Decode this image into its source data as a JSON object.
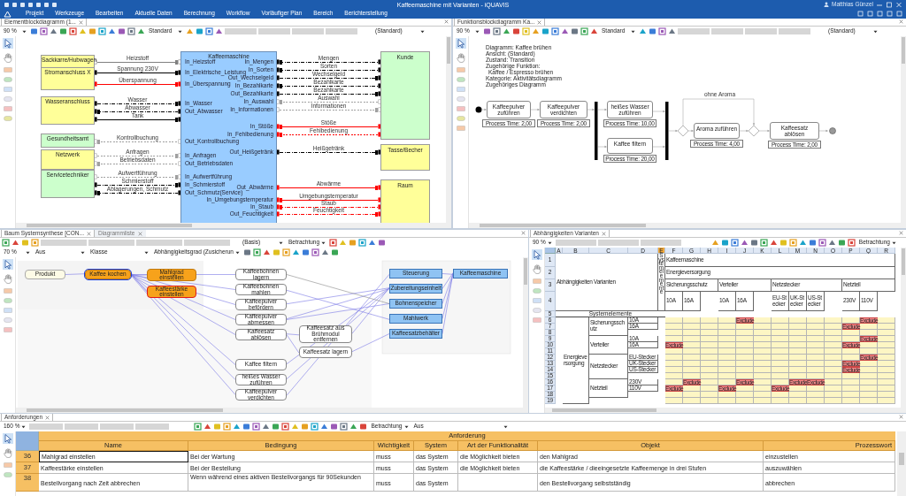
{
  "app": {
    "title": "Kaffeemaschine mit Varianten - iQUAVIS",
    "user": "Matthias Günzel",
    "menu": [
      "Projekt",
      "Werkzeuge",
      "Bearbeiten",
      "Aktuelle Daten",
      "Berechnung",
      "Workflow",
      "Vorläufiger Plan",
      "Bereich",
      "Berichterstellung"
    ]
  },
  "block_diagram": {
    "tab": {
      "label": "Elementblockdiagramm (1...",
      "selected": true
    },
    "zoom": "90 %",
    "view": "Standard",
    "state": "(Standard)",
    "center_block": "Kaffeemaschine",
    "left_blocks": [
      {
        "label": "Sackkarre/Hubwagen",
        "color": "#ffff99"
      },
      {
        "label": "Stromanschluss X",
        "color": "#ffff99"
      },
      {
        "label": "Wasseranschluss",
        "color": "#ffff99"
      },
      {
        "label": "Gesundheitsamt",
        "color": "#ccffcc"
      },
      {
        "label": "Netzwerk",
        "color": "#ffff99"
      },
      {
        "label": "Servicetechniker",
        "color": "#ccffcc"
      }
    ],
    "right_blocks": [
      {
        "label": "Kunde",
        "color": "#ccffcc"
      },
      {
        "label": "Tasse/Becher",
        "color": "#ffff99"
      },
      {
        "label": "Raum",
        "color": "#ffff99"
      }
    ],
    "left_connections": [
      {
        "label": "Heizstoff",
        "port": "In_Heizstoff",
        "color": "#808080",
        "kind": "solid_in"
      },
      {
        "label": "Spannung 230V",
        "port": "In_Elektrische_Leistung",
        "color": "#000000",
        "kind": "solid_in"
      },
      {
        "label": "Überspannung",
        "port": "In_Überspannung",
        "color": "#ff0000",
        "kind": "solid_in"
      },
      {
        "label": "Wasser",
        "port": "In_Wasser",
        "color": "#000000",
        "kind": "dashdot_in"
      },
      {
        "label": "Abwasser",
        "port": "Out_Abwasser",
        "color": "#000000",
        "kind": "dashdot_out"
      },
      {
        "label": "Tank",
        "color": "#000000",
        "kind": "solid_in"
      },
      {
        "label": "Kontrollbuchung",
        "port": "Out_Kontrollbuchung",
        "color": "#a0a0a0",
        "kind": "dashed_out"
      },
      {
        "label": "Anfragen",
        "port": "In_Anfragen",
        "color": "#a0a0a0",
        "kind": "dashed_in"
      },
      {
        "label": "Betriebsdaten",
        "port": "Out_Betriebsdaten",
        "color": "#a0a0a0",
        "kind": "dashed_out"
      },
      {
        "label": "Aufwertführung",
        "port": "In_Aufwertführung",
        "color": "#a0a0a0",
        "kind": "dashed_in"
      },
      {
        "label": "Schmierstoff",
        "port": "In_Schmierstoff",
        "color": "#000000",
        "kind": "dashdot_in"
      },
      {
        "label": "Ablagerungen, Schmutz",
        "port": "Out_Schmutz(Service)",
        "color": "#000000",
        "kind": "dashdot_out"
      }
    ],
    "right_connections": [
      {
        "label": "Mengen",
        "port": "In_Mengen",
        "color": "#000000",
        "kind": "dashdot_in"
      },
      {
        "label": "Sorten",
        "port": "In_Sorten",
        "color": "#000000",
        "kind": "dashdot_in"
      },
      {
        "label": "Wechselgeld",
        "port": "Out_Wechselgeld",
        "color": "#000000",
        "kind": "dashdot_out"
      },
      {
        "label": "Bezahlkarte",
        "port": "In_Bezahlkarte",
        "color": "#000000",
        "kind": "dashdot_in"
      },
      {
        "label": "Bezahlkarte",
        "port": "Out_Bezahlkarte",
        "color": "#000000",
        "kind": "dashdot_out"
      },
      {
        "label": "Auswahl",
        "port": "In_Auswahl",
        "color": "#a0a0a0",
        "kind": "dashed_in"
      },
      {
        "label": "Informationen",
        "port": "In_Informationen",
        "color": "#a0a0a0",
        "kind": "dashed_out"
      },
      {
        "label": "Stöße",
        "port": "In_Stöße",
        "color": "#ff0000",
        "kind": "solid_in"
      },
      {
        "label": "Fehlbedienung",
        "port": "In_Fehlbedienung",
        "color": "#ff0000",
        "kind": "dashed_in"
      },
      {
        "label": "Heißgetränk",
        "port": "Out_Heißgetränk",
        "color": "#000000",
        "kind": "dashdot_out"
      },
      {
        "label": "Abwärme",
        "port": "Out_Abwärme",
        "color": "#ff0000",
        "kind": "solid_out"
      },
      {
        "label": "Umgebungstemperatur",
        "port": "In_Umgebungstemperatur",
        "color": "#ff0000",
        "kind": "solid_in"
      },
      {
        "label": "Staub",
        "port": "In_Staub",
        "color": "#ff0000",
        "kind": "dashdot_in"
      },
      {
        "label": "Feuchtigkeit",
        "port": "Out_Feuchtigkeit",
        "color": "#ff0000",
        "kind": "dashdot_out"
      }
    ]
  },
  "function_diagram": {
    "tab": {
      "label": "Funktionsblockdiagramm Ka...",
      "selected": true
    },
    "zoom": "90 %",
    "view": "Standard",
    "state": "(Standard)",
    "legend": [
      "Diagramm: Kaffee brühen",
      "Ansicht: (Standard)",
      "Zustand: Transition",
      "Zugehörige Funktion:",
      "Kaffee / Espresso brühen",
      "Kategorie: Aktivitätsdiagramm",
      "Zugehöriges Diagramm"
    ],
    "branch_label": "ohne Aroma",
    "activities": [
      {
        "label": "Kaffeepulver zuführen",
        "process_time": "Process Time: 2,00"
      },
      {
        "label": "Kaffeepulver verdichten",
        "process_time": "Process Time: 2,00"
      },
      {
        "label": "heißes Wasser zuführen",
        "process_time": "Process Time: 10,00"
      },
      {
        "label": "Kaffee filtern",
        "process_time": "Process Time: 20,00"
      },
      {
        "label": "Aroma zuführen",
        "process_time": "Process Time: 4,00"
      },
      {
        "label": "Kaffeesatz ablösen",
        "process_time": "Process Time: 2,00"
      }
    ]
  },
  "system_tree": {
    "tabs": [
      {
        "label": "Baum Systemsynthese [CON...",
        "selected": true
      },
      {
        "label": "Diagrammliste",
        "selected": false
      }
    ],
    "view": "(Basis)",
    "mode": "Betrachtung",
    "zoom": "70 %",
    "filter": "Aus",
    "class": "Klasse",
    "dependency": "Abhängigkeitsgrad (Zusicherun",
    "nodes": [
      {
        "label": "Produkt",
        "kind": "product",
        "selected": false,
        "flagged": false
      },
      {
        "label": "Kaffee kochen",
        "kind": "function",
        "selected": true,
        "flagged": false
      },
      {
        "label": "Mahlgrad einstellen",
        "kind": "function",
        "selected": false,
        "flagged": false
      },
      {
        "label": "Kaffeestärke einstellen",
        "kind": "function",
        "selected": false,
        "flagged": true
      },
      {
        "label": "Kaffeebohnen lagern",
        "kind": "process",
        "selected": false,
        "flagged": false
      },
      {
        "label": "Kaffeebohnen mahlen",
        "kind": "process",
        "selected": false,
        "flagged": false
      },
      {
        "label": "Kaffeepulver befördern",
        "kind": "process",
        "selected": false,
        "flagged": false
      },
      {
        "label": "Kaffeepulver abmessen",
        "kind": "process",
        "selected": false,
        "flagged": false
      },
      {
        "label": "Kaffeesatz ablösen",
        "kind": "process",
        "selected": false,
        "flagged": false
      },
      {
        "label": "Kaffee filtern",
        "kind": "process",
        "selected": false,
        "flagged": false
      },
      {
        "label": "heißes Wasser zuführen",
        "kind": "process",
        "selected": false,
        "flagged": false
      },
      {
        "label": "Kaffeepulver verdichten",
        "kind": "process",
        "selected": false,
        "flagged": false
      },
      {
        "label": "Kaffeesatz aus Brühmodul entfernen",
        "kind": "process",
        "selected": false,
        "flagged": false
      },
      {
        "label": "Kaffeesatz lagern",
        "kind": "process",
        "selected": false,
        "flagged": false
      },
      {
        "label": "Steuerung",
        "kind": "component",
        "selected": false,
        "flagged": false
      },
      {
        "label": "Zubereitungseinheit",
        "kind": "component",
        "selected": false,
        "flagged": false
      },
      {
        "label": "Bohnenspeicher",
        "kind": "component",
        "selected": false,
        "flagged": false
      },
      {
        "label": "Mahlwerk",
        "kind": "component",
        "selected": false,
        "flagged": false
      },
      {
        "label": "Kaffeesatzbehälter",
        "kind": "component",
        "selected": false,
        "flagged": false
      },
      {
        "label": "Kaffeemaschine",
        "kind": "component",
        "selected": false,
        "flagged": false
      }
    ]
  },
  "variant_matrix": {
    "tab": {
      "label": "Abhängigkeiten Varianten",
      "selected": true
    },
    "zoom": "90 %",
    "mode": "Betrachtung",
    "columns": [
      "A",
      "B",
      "C",
      "D",
      "E",
      "F",
      "G",
      "H",
      "I",
      "J",
      "K",
      "L",
      "M",
      "N",
      "O",
      "P",
      "Q",
      "R"
    ],
    "rows": [
      "1",
      "2",
      "3",
      "4",
      "5",
      "6",
      "7",
      "8",
      "9",
      "10",
      "11",
      "12",
      "13",
      "14",
      "15",
      "16",
      "17",
      "18",
      "19"
    ],
    "cells": [
      {
        "text": "Abhängigkeiten Varianten",
        "kind": "header"
      },
      {
        "text": "Systemelemente",
        "kind": "vertical"
      },
      {
        "text": "Kaffeemaschine",
        "kind": "header"
      },
      {
        "text": "Energieversorgung",
        "kind": "header"
      },
      {
        "text": "Sicherungsschutz",
        "kind": "header"
      },
      {
        "text": "Verteiler",
        "kind": "header"
      },
      {
        "text": "Netzstecker",
        "kind": "header"
      },
      {
        "text": "Netzteil",
        "kind": "header"
      },
      {
        "text": "10A",
        "kind": "header"
      },
      {
        "text": "16A",
        "kind": "header"
      },
      {
        "text": "10A",
        "kind": "header"
      },
      {
        "text": "16A",
        "kind": "header"
      },
      {
        "text": "EU-Stecker",
        "kind": "header"
      },
      {
        "text": "UK-Stecker",
        "kind": "header"
      },
      {
        "text": "US-Stecker",
        "kind": "header"
      },
      {
        "text": "230V",
        "kind": "header"
      },
      {
        "text": "110V",
        "kind": "header"
      },
      {
        "text": "Systemelemente",
        "kind": "centered"
      },
      {
        "text": "Energieversorgung",
        "kind": "header"
      },
      {
        "text": "Sicherungsschutz",
        "kind": "header"
      },
      {
        "text": "Verteiler",
        "kind": "header"
      },
      {
        "text": "Netzstecker",
        "kind": "header"
      },
      {
        "text": "Netzteil",
        "kind": "header"
      },
      {
        "text": "10A",
        "kind": "header"
      },
      {
        "text": "16A",
        "kind": "header"
      },
      {
        "text": "10A",
        "kind": "header"
      },
      {
        "text": "16A",
        "kind": "header"
      },
      {
        "text": "EU-Stecker",
        "kind": "header"
      },
      {
        "text": "UK-Stecker",
        "kind": "header"
      },
      {
        "text": "US-Stecker",
        "kind": "header"
      },
      {
        "text": "230V",
        "kind": "header"
      },
      {
        "text": "110V",
        "kind": "header"
      },
      {
        "text": "Exclude",
        "kind": "exclude"
      },
      {
        "text": "Exclude",
        "kind": "exclude"
      },
      {
        "text": "Exclude",
        "kind": "exclude"
      },
      {
        "text": "Exclude",
        "kind": "exclude"
      },
      {
        "text": "Exclude",
        "kind": "exclude"
      },
      {
        "text": "Exclude",
        "kind": "exclude"
      },
      {
        "text": "Exclude",
        "kind": "exclude"
      },
      {
        "text": "Exclude",
        "kind": "exclude"
      },
      {
        "text": "Exclude",
        "kind": "exclude"
      },
      {
        "text": "Exclude",
        "kind": "exclude"
      },
      {
        "text": "Exclude",
        "kind": "exclude"
      },
      {
        "text": "Exclude",
        "kind": "exclude"
      },
      {
        "text": "Exclude",
        "kind": "exclude"
      },
      {
        "text": "Exclude",
        "kind": "exclude"
      },
      {
        "text": "Exclude",
        "kind": "exclude"
      },
      {
        "text": "Exclude",
        "kind": "exclude"
      }
    ]
  },
  "requirements": {
    "tab": {
      "label": "Anforderungen",
      "selected": true
    },
    "zoom": "160 %",
    "mode": "Betrachtung",
    "filter": "Aus",
    "group_header": "Anforderung",
    "columns": [
      "Name",
      "Bedingung",
      "Wichtigkeit",
      "System",
      "Art der Funktionalität",
      "Objekt",
      "Prozesswort"
    ],
    "rows": [
      {
        "number": "36",
        "selected": true,
        "cells": [
          "Mahlgrad einstellen",
          "Bei der Wartung",
          "muss",
          "das System",
          "die Möglichkeit bieten",
          "den Mahlgrad",
          "einzustellen"
        ]
      },
      {
        "number": "37",
        "selected": false,
        "cells": [
          "Kaffeestärke einstellen",
          "Bei der Bestellung",
          "muss",
          "das System",
          "die Möglichkeit bieten",
          "die Kaffeestärke / dieeingesetzte Kaffeemenge in drei Stufen",
          "auszuwählen"
        ]
      },
      {
        "number": "38",
        "selected": false,
        "cells": [
          "Bestellvorgang nach Zeit abbrechen",
          "Wenn während eines aktiven Bestellvorgangs für 90Sekunden",
          "muss",
          "das System",
          null,
          "den Bestellvorgang selbstständig",
          "abbrechen"
        ]
      }
    ]
  }
}
